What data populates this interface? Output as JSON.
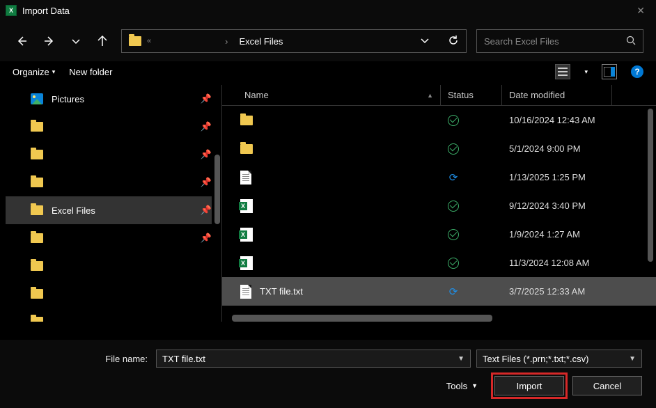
{
  "window": {
    "title": "Import Data"
  },
  "nav": {
    "address_crumb": "Excel Files",
    "search_placeholder": "Search Excel Files"
  },
  "toolbar": {
    "organize": "Organize",
    "new_folder": "New folder"
  },
  "sidebar": {
    "items": [
      {
        "label": "Pictures",
        "icon": "picture",
        "pinned": true,
        "selected": false
      },
      {
        "label": "",
        "icon": "folder",
        "pinned": true,
        "selected": false
      },
      {
        "label": "",
        "icon": "folder",
        "pinned": true,
        "selected": false
      },
      {
        "label": "",
        "icon": "folder",
        "pinned": true,
        "selected": false
      },
      {
        "label": "Excel Files",
        "icon": "folder",
        "pinned": true,
        "selected": true
      },
      {
        "label": "",
        "icon": "folder",
        "pinned": true,
        "selected": false
      },
      {
        "label": "",
        "icon": "folder",
        "pinned": false,
        "selected": false
      },
      {
        "label": "",
        "icon": "folder",
        "pinned": false,
        "selected": false
      },
      {
        "label": "",
        "icon": "folder",
        "pinned": false,
        "selected": false
      }
    ]
  },
  "columns": {
    "name": "Name",
    "status": "Status",
    "date": "Date modified"
  },
  "files": [
    {
      "name": "",
      "icon": "folder",
      "status": "ok",
      "date": "10/16/2024 12:43 AM",
      "selected": false
    },
    {
      "name": "",
      "icon": "folder",
      "status": "ok",
      "date": "5/1/2024 9:00 PM",
      "selected": false
    },
    {
      "name": "",
      "icon": "file",
      "status": "sync",
      "date": "1/13/2025 1:25 PM",
      "selected": false
    },
    {
      "name": "",
      "icon": "xls",
      "status": "ok",
      "date": "9/12/2024 3:40 PM",
      "selected": false
    },
    {
      "name": "",
      "icon": "xls",
      "status": "ok",
      "date": "1/9/2024 1:27 AM",
      "selected": false
    },
    {
      "name": "",
      "icon": "xls",
      "status": "ok",
      "date": "11/3/2024 12:08 AM",
      "selected": false
    },
    {
      "name": "TXT file.txt",
      "icon": "file",
      "status": "sync",
      "date": "3/7/2025 12:33 AM",
      "selected": true
    }
  ],
  "footer": {
    "file_name_label": "File name:",
    "file_name_value": "TXT file.txt",
    "file_type_value": "Text Files (*.prn;*.txt;*.csv)",
    "tools_label": "Tools",
    "import_label": "Import",
    "cancel_label": "Cancel"
  },
  "help_char": "?"
}
